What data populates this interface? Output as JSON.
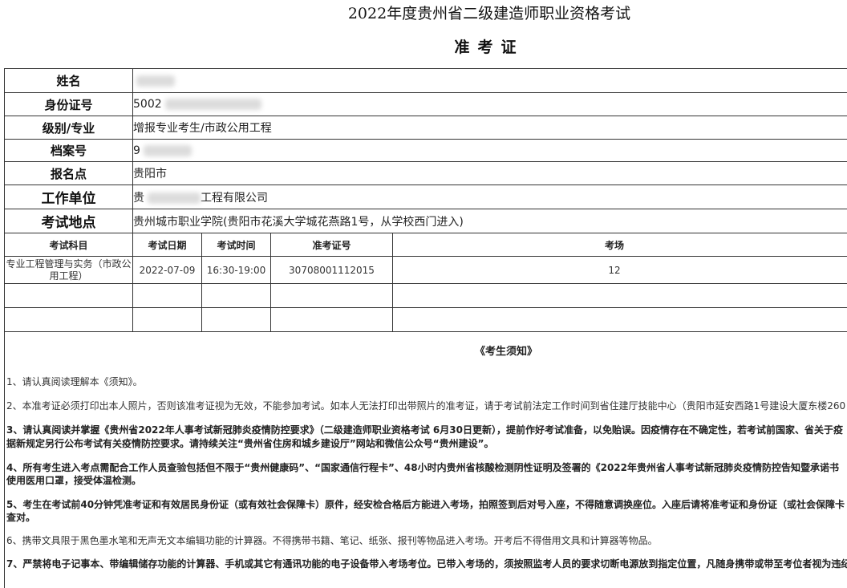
{
  "header": {
    "title": "2022年度贵州省二级建造师职业资格考试",
    "subtitle": "准考证"
  },
  "candidate": {
    "name_label": "姓名",
    "name_value": "",
    "id_label": "身份证号",
    "id_value": "5002",
    "level_label": "级别/专业",
    "level_value": "增报专业考生/市政公用工程",
    "file_label": "档案号",
    "file_value": "9",
    "site_label": "报名点",
    "site_value": "贵阳市",
    "employer_label": "工作单位",
    "employer_prefix": "贵",
    "employer_suffix": "工程有限公司",
    "location_label": "考试地点",
    "location_value": "贵州城市职业学院(贵阳市花溪大学城花燕路1号，从学校西门进入)"
  },
  "exam_table": {
    "headers": [
      "考试科目",
      "考试日期",
      "考试时间",
      "准考证号",
      "考场"
    ],
    "rows": [
      [
        "专业工程管理与实务（市政公用工程）",
        "2022-07-09",
        "16:30-19:00",
        "30708001112015",
        "12"
      ]
    ]
  },
  "notice": {
    "title": "《考生须知》",
    "items": [
      "1、请认真阅读理解本《须知》。",
      "2、本准考证必须打印出本人照片，否则该准考证视为无效，不能参加考试。如本人无法打印出带照片的准考证，请于考试前法定工作时间到省住建厅技能中心（贵阳市延安西路1号建设大厦东楼260",
      "3、请认真阅读并掌握《贵州省2022年人事考试新冠肺炎疫情防控要求》（二级建造师职业资格考试 6月30日更新），提前作好考试准备，以免贻误。因疫情存在不确定性，若考试前国家、省关于疫",
      "据新规定另行公布考试有关疫情防控要求。请持续关注“贵州省住房和城乡建设厅”网站和微信公众号“贵州建设”。",
      "4、所有考生进入考点需配合工作人员查验包括但不限于“贵州健康码”、“国家通信行程卡”、48小时内贵州省核酸检测阴性证明及签署的《2022年贵州省人事考试新冠肺炎疫情防控告知暨承诺书",
      "使用医用口罩，接受体温检测。",
      "5、考生在考试前40分钟凭准考证和有效居民身份证（或有效社会保障卡）原件，经安检合格后方能进入考场，拍照签到后对号入座，不得随意调换座位。入座后请将准考证和身份证（或社会保障卡",
      "查对。",
      "6、携带文具限于黑色墨水笔和无声无文本编辑功能的计算器。不得携带书籍、笔记、纸张、报刊等物品进入考场。开考后不得借用文具和计算器等物品。",
      "7、严禁将电子记事本、带编辑储存功能的计算器、手机或其它有通讯功能的电子设备带入考场考位。已带入考场的，须按照监考人员的要求切断电源放到指定位置，凡随身携带或带至考位者视为违纪"
    ]
  }
}
